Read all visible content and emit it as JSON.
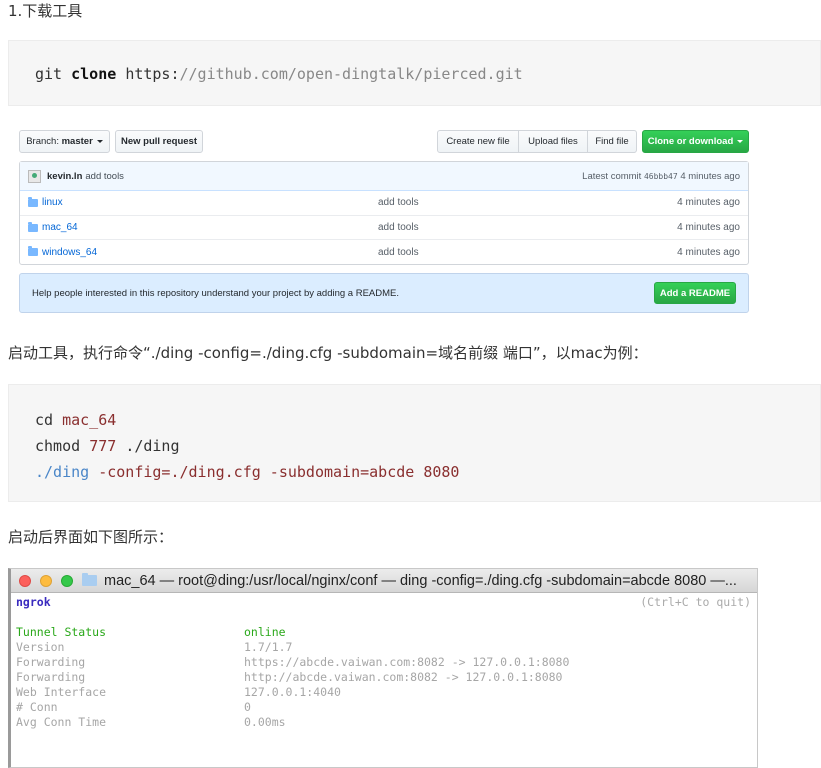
{
  "headings": {
    "step1": "1.下载工具",
    "step2": "启动工具，执行命令“./ding -config=./ding.cfg -subdomain=域名前缀 端口”，以mac为例：",
    "step3": "启动后界面如下图所示："
  },
  "code1": {
    "cmd": "git",
    "kw": "clone",
    "url_prefix": "https:",
    "url_rest": "//github.com/open-dingtalk/pierced.git"
  },
  "code2": {
    "line1_cmd": "cd",
    "line1_arg": "mac_64",
    "line2_cmd": "chmod",
    "line2_num": "777",
    "line2_path": "./ding",
    "line3_path": "./ding",
    "line3_rest": "-config=./ding.cfg -subdomain=abcde 8080"
  },
  "github": {
    "branch_prefix": "Branch:",
    "branch_name": "master",
    "new_pull_request": "New pull request",
    "create_new_file": "Create new file",
    "upload_files": "Upload files",
    "find_file": "Find file",
    "clone_or_download": "Clone or download",
    "commit_author": "kevin.ln",
    "commit_message": "add tools",
    "latest_commit_label": "Latest commit",
    "latest_commit_sha": "46bbb47",
    "latest_commit_age": "4 minutes ago",
    "files": [
      {
        "name": "linux",
        "message": "add tools",
        "age": "4 minutes ago"
      },
      {
        "name": "mac_64",
        "message": "add tools",
        "age": "4 minutes ago"
      },
      {
        "name": "windows_64",
        "message": "add tools",
        "age": "4 minutes ago"
      }
    ],
    "readme_prompt": "Help people interested in this repository understand your project by adding a README.",
    "add_readme": "Add a README"
  },
  "terminal": {
    "title": "mac_64 — root@ding:/usr/local/nginx/conf — ding -config=./ding.cfg -subdomain=abcde 8080 —...",
    "app_name": "ngrok",
    "quit_hint": "(Ctrl+C to quit)",
    "rows": [
      {
        "label": "Tunnel Status",
        "value": "online"
      },
      {
        "label": "Version",
        "value": "1.7/1.7"
      },
      {
        "label": "Forwarding",
        "value": "https://abcde.vaiwan.com:8082 -> 127.0.0.1:8080"
      },
      {
        "label": "Forwarding",
        "value": "http://abcde.vaiwan.com:8082 -> 127.0.0.1:8080"
      },
      {
        "label": "Web Interface",
        "value": "127.0.0.1:4040"
      },
      {
        "label": "# Conn",
        "value": "0"
      },
      {
        "label": "Avg Conn Time",
        "value": "0.00ms"
      }
    ]
  }
}
